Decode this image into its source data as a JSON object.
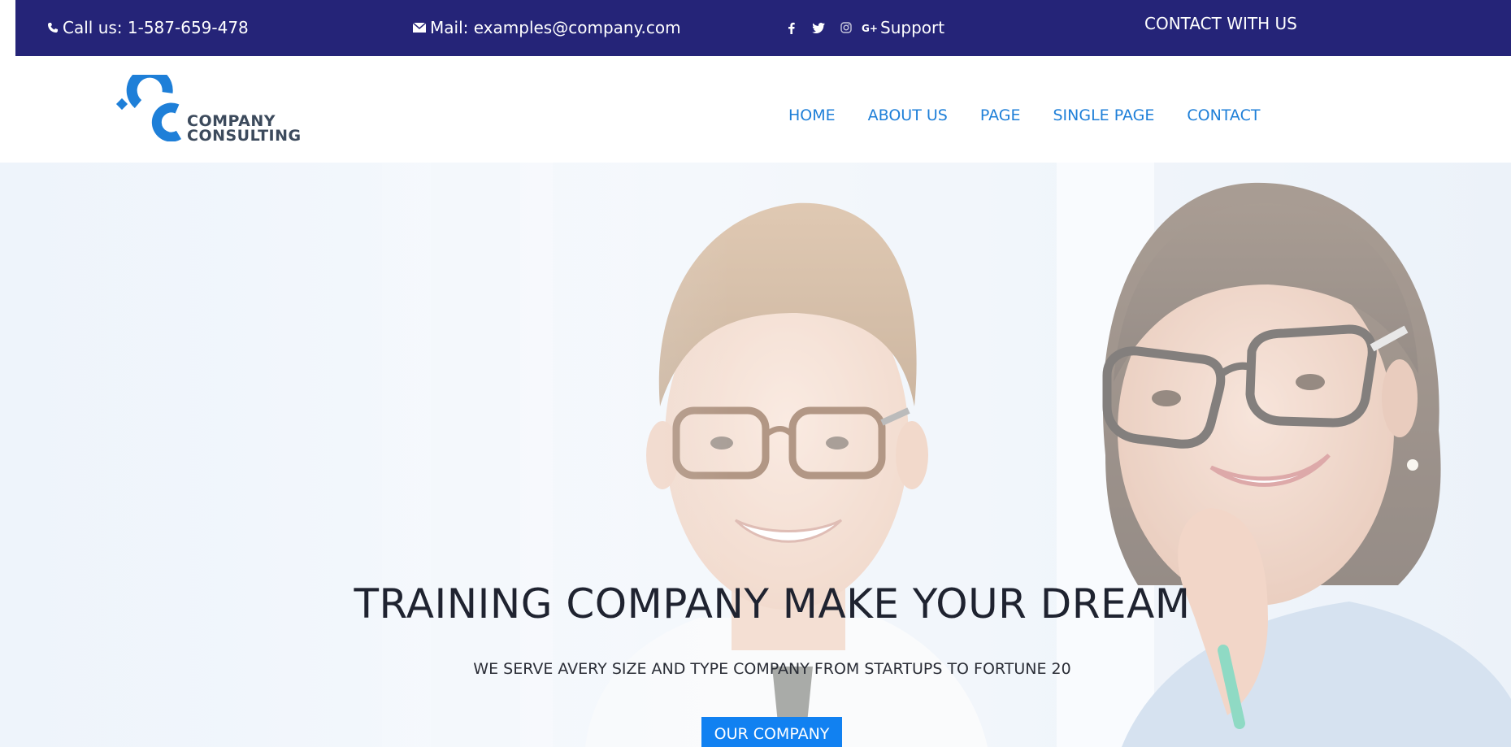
{
  "topbar": {
    "phone": "Call us: 1-587-659-478",
    "mail": "Mail: examples@company.com",
    "support": "Support",
    "contact_with_us": "CONTACT WITH US",
    "social_icons": [
      "facebook-icon",
      "twitter-icon",
      "instagram-icon",
      "google-plus-icon"
    ],
    "background_color": "#252478"
  },
  "logo": {
    "line1": "COMPANY",
    "line2": "CONSULTING",
    "brand_color": "#1e7fd8"
  },
  "nav": {
    "items": [
      "HOME",
      "ABOUT US",
      "PAGE",
      "SINGLE PAGE",
      "CONTACT"
    ],
    "link_color": "#1e7fd8"
  },
  "hero": {
    "title": "TRAINING COMPANY MAKE YOUR DREAM",
    "subtitle": "WE SERVE AVERY SIZE AND TYPE COMPANY FROM STARTUPS TO FORTUNE 20",
    "button_label": "OUR COMPANY",
    "button_color": "#1181f1"
  }
}
